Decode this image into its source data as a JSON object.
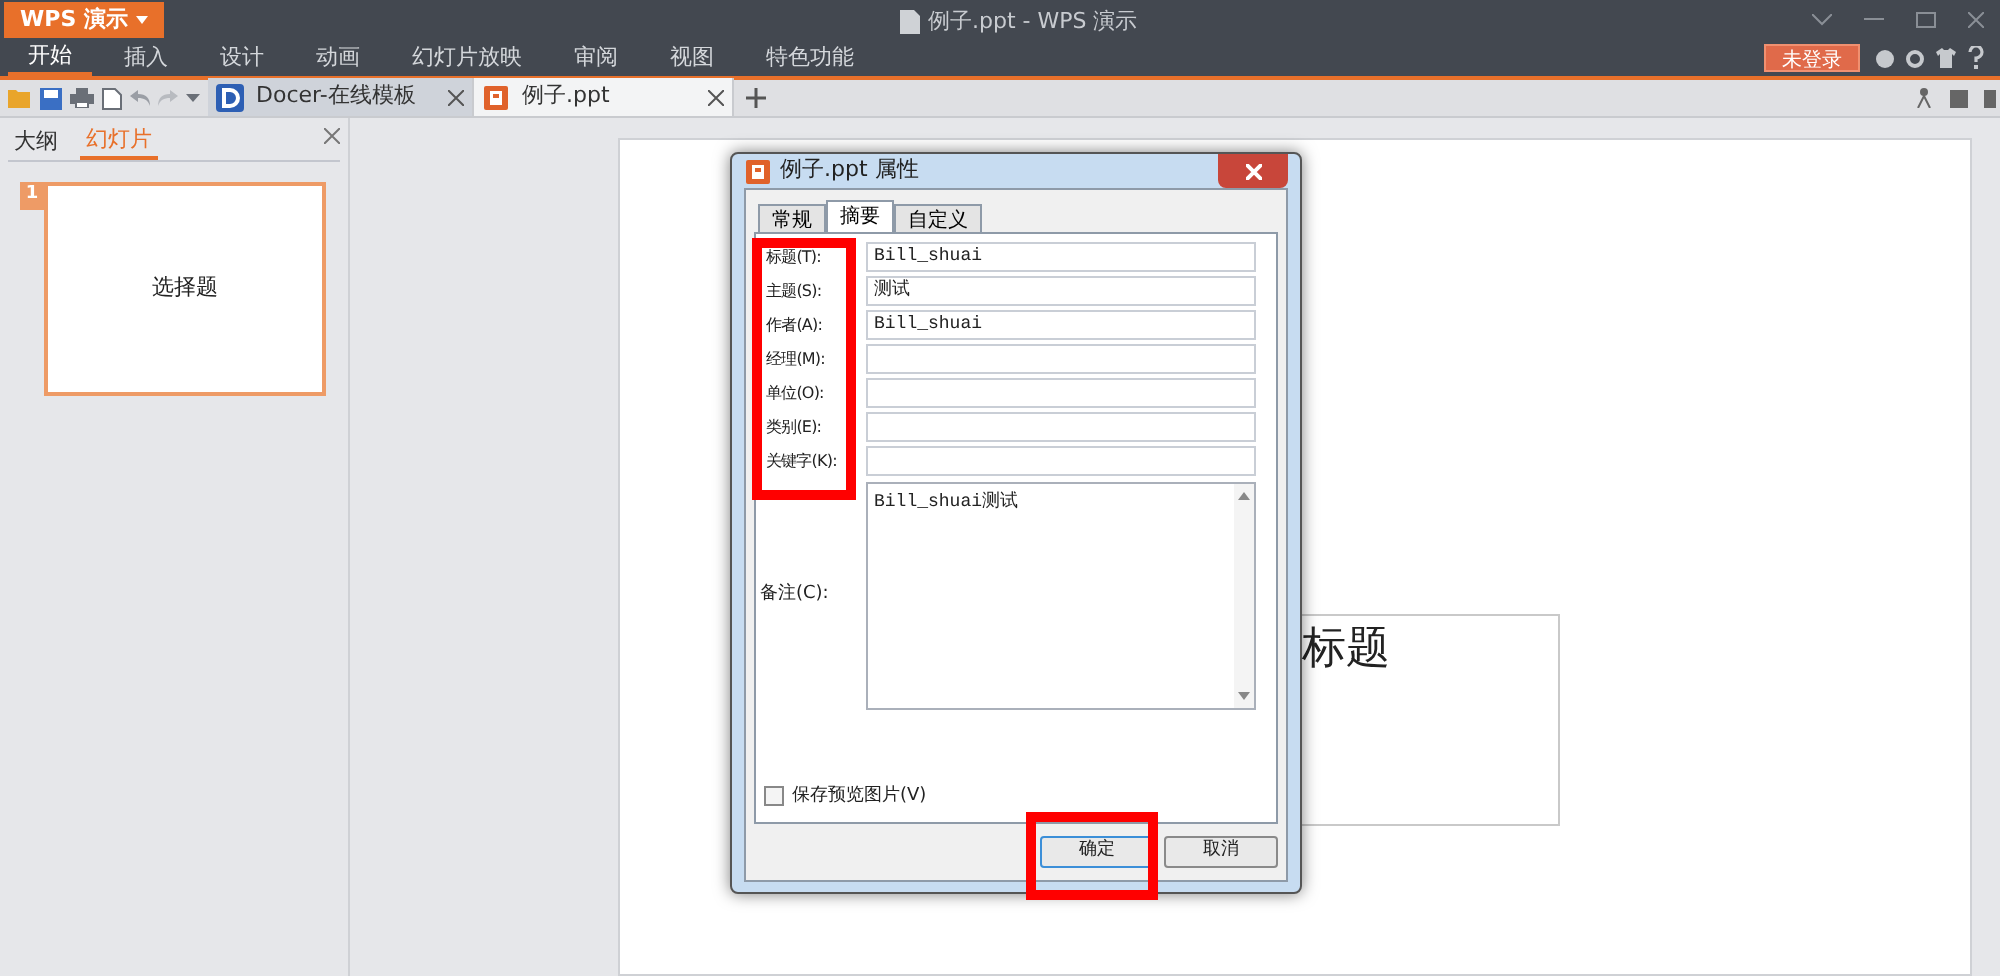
{
  "app_button": "WPS 演示",
  "window": {
    "title": "例子.ppt - WPS 演示"
  },
  "menu": [
    {
      "label": "开始",
      "selected": true
    },
    {
      "label": "插入",
      "selected": false
    },
    {
      "label": "设计",
      "selected": false
    },
    {
      "label": "动画",
      "selected": false
    },
    {
      "label": "幻灯片放映",
      "selected": false
    },
    {
      "label": "审阅",
      "selected": false
    },
    {
      "label": "视图",
      "selected": false
    },
    {
      "label": "特色功能",
      "selected": false
    }
  ],
  "login_button": "未登录",
  "doc_tabs": [
    {
      "label": "Docer-在线模板",
      "kind": "docer",
      "selected": false
    },
    {
      "label": "例子.ppt",
      "kind": "ppt",
      "selected": true
    }
  ],
  "side_panel": {
    "tabs": [
      {
        "label": "大纲",
        "selected": false
      },
      {
        "label": "幻灯片",
        "selected": true
      }
    ],
    "slides": [
      {
        "number": "1",
        "text": "选择题",
        "selected": true
      }
    ]
  },
  "slide": {
    "placeholder_text": "标题"
  },
  "dialog": {
    "title": "例子.ppt 属性",
    "tabs": [
      {
        "label": "常规",
        "selected": false
      },
      {
        "label": "摘要",
        "selected": true
      },
      {
        "label": "自定义",
        "selected": false
      }
    ],
    "fields": [
      {
        "label": "标题(T):",
        "value": "Bill_shuai"
      },
      {
        "label": "主题(S):",
        "value": "测试"
      },
      {
        "label": "作者(A):",
        "value": "Bill_shuai"
      },
      {
        "label": "经理(M):"
      },
      {
        "label": "单位(O):"
      },
      {
        "label": "类别(E):"
      },
      {
        "label": "关键字(K):"
      }
    ],
    "memo": {
      "label": "备注(C):",
      "value": "Bill_shuai测试"
    },
    "save_preview": {
      "label": "保存预览图片(V)",
      "checked": false
    },
    "buttons": [
      {
        "label": "确定",
        "kind": "default"
      },
      {
        "label": "取消",
        "kind": "normal"
      }
    ]
  }
}
